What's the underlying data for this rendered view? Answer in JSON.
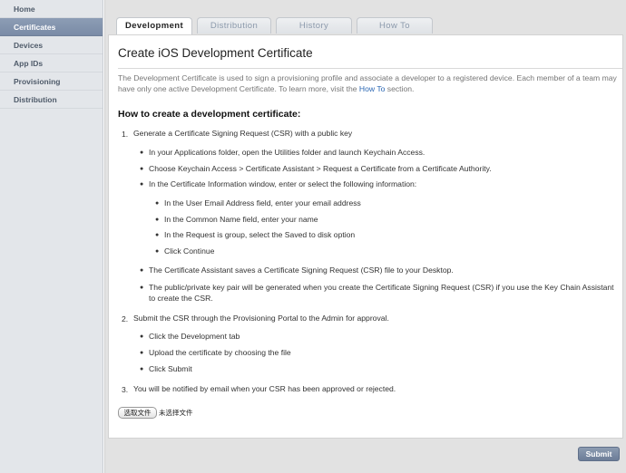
{
  "sidebar": {
    "items": [
      {
        "label": "Home"
      },
      {
        "label": "Certificates"
      },
      {
        "label": "Devices"
      },
      {
        "label": "App IDs"
      },
      {
        "label": "Provisioning"
      },
      {
        "label": "Distribution"
      }
    ],
    "active_index": 1
  },
  "tabs": [
    {
      "label": "Development"
    },
    {
      "label": "Distribution"
    },
    {
      "label": "History"
    },
    {
      "label": "How To"
    }
  ],
  "main": {
    "title": "Create iOS Development Certificate",
    "intro_text": "The Development Certificate is used to sign a provisioning profile and associate a developer to a registered device. Each member of a team may have only one active Development Certificate. To learn more, visit the ",
    "intro_link": "How To",
    "intro_suffix": " section.",
    "howto_heading": "How to create a development certificate:",
    "steps": [
      {
        "number": "1.",
        "text": "Generate a Certificate Signing Request (CSR) with a public key",
        "bullets": [
          "In your Applications folder, open the Utilities folder and launch Keychain Access.",
          "Choose Keychain Access > Certificate Assistant > Request a Certificate from a Certificate Authority.",
          "In the Certificate Information window, enter or select the following information:"
        ],
        "sub_bullets": [
          "In the User Email Address field, enter your email address",
          "In the Common Name field, enter your name",
          "In the Request is group, select the Saved to disk option",
          "Click Continue"
        ],
        "bullets_after": [
          "The Certificate Assistant saves a Certificate Signing Request (CSR) file to your Desktop.",
          "The public/private key pair will be generated when you create the Certificate Signing Request (CSR) if you use the Key Chain Assistant to create the CSR."
        ]
      },
      {
        "number": "2.",
        "text": "Submit the CSR through the Provisioning Portal to the Admin for approval.",
        "bullets": [
          "Click the Development tab",
          "Upload the certificate by choosing the file",
          "Click Submit"
        ]
      },
      {
        "number": "3.",
        "text": "You will be notified by email when your CSR has been approved or rejected."
      }
    ],
    "file_button_label": "选取文件",
    "file_status": "未选择文件",
    "submit_label": "Submit"
  },
  "colors": {
    "sidebar_active": "#7f90aa",
    "link": "#2b67b3",
    "submit": "#7a8aa4"
  },
  "icons": {
    "bullet": "bullet-dot"
  }
}
